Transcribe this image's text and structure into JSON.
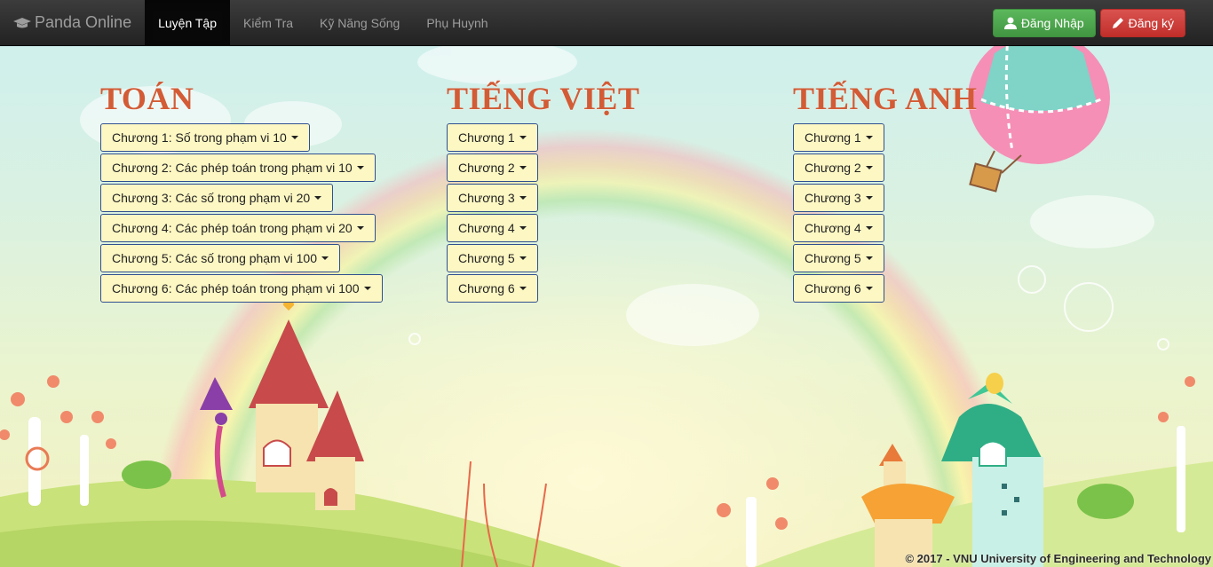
{
  "nav": {
    "brand": "Panda Online",
    "brand_icon": "graduation-cap-icon",
    "items": [
      {
        "label": "Luyện Tập",
        "active": true
      },
      {
        "label": "Kiểm Tra",
        "active": false
      },
      {
        "label": "Kỹ Năng Sống",
        "active": false
      },
      {
        "label": "Phụ Huynh",
        "active": false
      }
    ],
    "login_label": "Đăng Nhập",
    "login_icon": "user-icon",
    "signup_label": "Đăng ký",
    "signup_icon": "pencil-icon"
  },
  "subjects": [
    {
      "title": "TOÁN",
      "chapters": [
        "Chương 1: Số trong phạm vi 10",
        "Chương 2: Các phép toán trong phạm vi 10",
        "Chương 3: Các số trong phạm vi 20",
        "Chương 4: Các phép toán trong phạm vi 20",
        "Chương 5: Các số trong phạm vi 100",
        "Chương 6: Các phép toán trong phạm vi 100"
      ]
    },
    {
      "title": "TIẾNG VIỆT",
      "chapters": [
        "Chương 1",
        "Chương 2",
        "Chương 3",
        "Chương 4",
        "Chương 5",
        "Chương 6"
      ]
    },
    {
      "title": "TIẾNG ANH",
      "chapters": [
        "Chương 1",
        "Chương 2",
        "Chương 3",
        "Chương 4",
        "Chương 5",
        "Chương 6"
      ]
    }
  ],
  "footer": "© 2017 - VNU University of Engineering and Technology",
  "colors": {
    "heading": "#d35b35",
    "chapter_bg": "#fdf7c3",
    "chapter_border": "#2f4f8f",
    "login_btn": "#5cb85c",
    "signup_btn": "#d9534f"
  }
}
